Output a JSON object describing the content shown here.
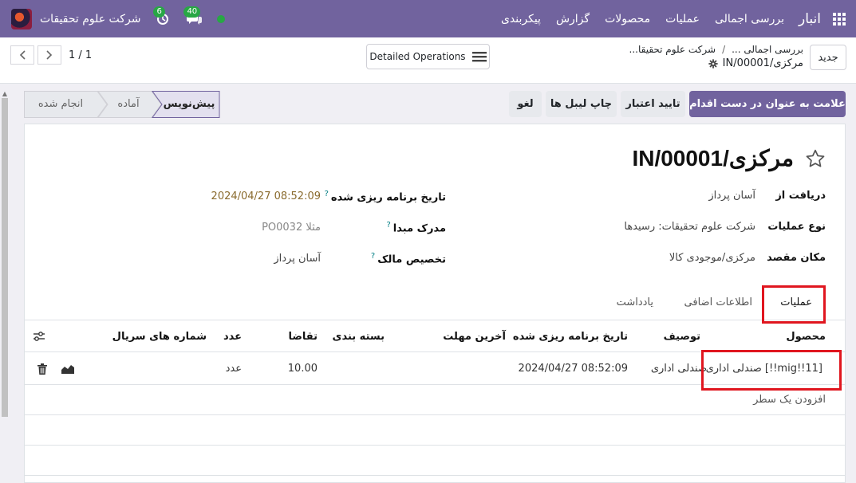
{
  "navbar": {
    "brand": "انبار",
    "menu": [
      "بررسی اجمالی",
      "عملیات",
      "محصولات",
      "گزارش",
      "پیکربندی"
    ],
    "company": "شرکت علوم تحقیقات",
    "activity_count": "6",
    "message_count": "40",
    "accent": "#71639e"
  },
  "control_panel": {
    "new_label": "جدید",
    "breadcrumb": [
      "بررسی اجمالی ...",
      "شرکت علوم تحقیقا..."
    ],
    "current_record": "مرکزی/IN/00001",
    "detailed_ops_label": "Detailed Operations",
    "pager": "1 / 1"
  },
  "statusbar": {
    "actions": [
      "علامت به عنوان در دست اقدام",
      "تایید اعتبار",
      "چاپ لیبل ها",
      "لغو"
    ],
    "stages": [
      "پیش‌نویس",
      "آماده",
      "انجام شده"
    ]
  },
  "form": {
    "title": "مرکزی/IN/00001",
    "fields_right": [
      {
        "label": "دریافت از",
        "value": "آسان پرداز"
      },
      {
        "label": "نوع عملیات",
        "value": "شرکت علوم تحقیقات: رسیدها"
      },
      {
        "label": "مکان مقصد",
        "value": "مرکزی/موجودی کالا"
      }
    ],
    "fields_left": [
      {
        "label": "تاریخ برنامه ریزی شده",
        "value": "2024/04/27 08:52:09"
      },
      {
        "label": "مدرک مبدا",
        "value": "مثلا PO0032"
      },
      {
        "label": "تخصیص مالک",
        "value": "آسان پرداز"
      }
    ],
    "help_mark": "?"
  },
  "tabs": [
    "عملیات",
    "اطلاعات اضافی",
    "یادداشت"
  ],
  "table": {
    "headers": [
      "محصول",
      "توصیف",
      "تاریخ برنامه ریزی شده",
      "آخرین مهلت",
      "بسته بندی",
      "تقاضا",
      "عدد",
      "شماره های سریال"
    ],
    "row": {
      "product": "[mig!!11!!] صندلی اداری",
      "description": "صندلی اداری",
      "scheduled": "2024/04/27 08:52:09",
      "deadline": "",
      "packaging": "",
      "demand": "10.00",
      "uom": "عدد",
      "serials": ""
    },
    "add_line": "افزودن یک سطر"
  }
}
